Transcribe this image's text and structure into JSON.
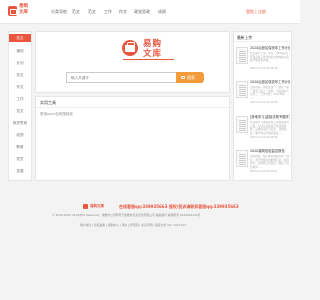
{
  "header": {
    "logo_text": "易购\n文库",
    "nav": [
      "分类导航",
      "范文",
      "范文",
      "工作",
      "作文",
      "政党思政",
      "成绩"
    ],
    "login_label": "登陆 | 注册"
  },
  "sidebar": {
    "items": [
      "范文",
      "通知",
      "计划",
      "范文",
      "作文",
      "工作",
      "范文",
      "政党思政",
      "成绩",
      "教育",
      "党员",
      "发展",
      "随机"
    ]
  },
  "hero": {
    "title": "易购\n文库",
    "search_placeholder": "输入关键字",
    "search_button": "搜索"
  },
  "content": {
    "title": "实用工具",
    "message": "恐怕xxxx没有搜到或"
  },
  "right": {
    "title": "最新上传",
    "docs": [
      {
        "title": "2020后营区保安年工作计划",
        "desc": "党员领导干部，中共，2020后营区保安年工作计划的主要内容以及执行保障等内容。。",
        "date": "2024-11-01 20:00:18"
      },
      {
        "title": "2020后营区保安年工作计划",
        "desc": "活动时间，由党支部一，委托（第一期第三批二）年龄，小班参加人员约二，工作计划，20xx年年 ……",
        "date": "2024-11-01 20:00:08"
      },
      {
        "title": "[营地学习]迎接法规专题学习",
        "desc": "年营地学习调配管理工作进度情况汇报，为切实实际执行的决策部署，完成各项学习任务，法规制度，教学活动开展的建设 ……",
        "date": "2024-11-01 20:00:06"
      },
      {
        "title": "2020建筑检验监控报告",
        "desc": "项目经理，属于本区域复查的一部分，并已经施行的检测记录，各位领导，对照施工的程序，确定了项目地区……",
        "date": "2024-11-01 20:00:01"
      }
    ]
  },
  "footer": {
    "logo_text": "易购文库",
    "contact": "在线客服qq:339935663    侵权/投诉请联系客服qq:339935663",
    "copyright": "© 2016-2022 All Rights Reserved，成都市公司所有于成都市某某文化有限公司 备案编号 版权所有 2024001234号",
    "links": "用户协议 | 隐私政策 | 帮助中心 | 用户上传须知 | 免责声明 | 联系方式 QQ: 2021124"
  }
}
